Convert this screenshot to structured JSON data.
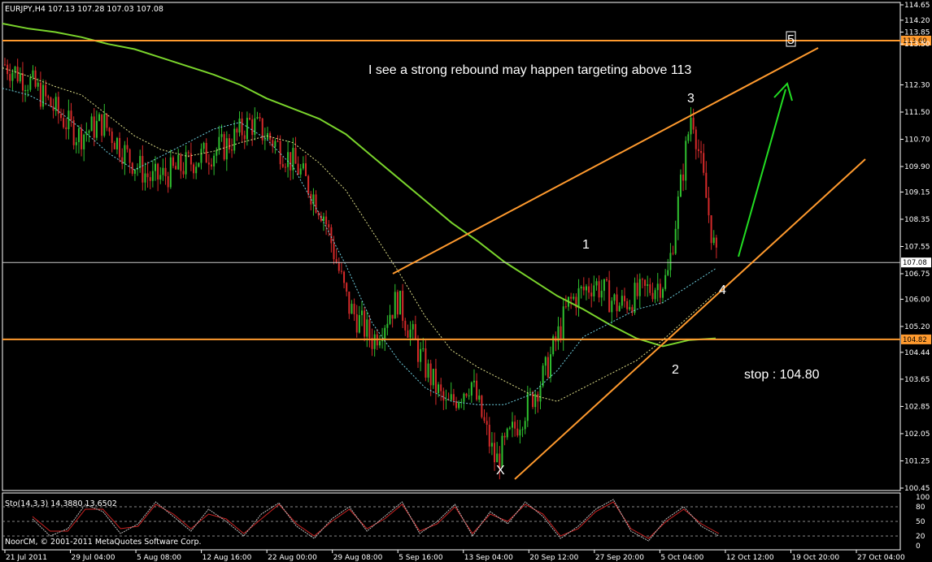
{
  "chart_data": {
    "type": "line",
    "title": "EURJPY,H4  107.13 107.28 107.03 107.08",
    "ylim": [
      100.45,
      114.65
    ],
    "y_ticks": [
      "114.65",
      "114.20",
      "113.85",
      "113.50",
      "112.30",
      "111.50",
      "110.70",
      "109.90",
      "109.15",
      "108.35",
      "107.55",
      "106.75",
      "106.00",
      "105.20",
      "104.44",
      "103.65",
      "102.85",
      "102.05",
      "101.25",
      "100.45"
    ],
    "price_tags": [
      {
        "label": "113.60",
        "value": 113.6,
        "style": "orange"
      },
      {
        "label": "107.08",
        "value": 107.08,
        "style": "white"
      },
      {
        "label": "104.82",
        "value": 104.82,
        "style": "orange"
      }
    ],
    "x_ticks": [
      "21 Jul 2011",
      "29 Jul 04:00",
      "5 Aug 08:00",
      "12 Aug 16:00",
      "22 Aug 00:00",
      "29 Aug 08:00",
      "5 Sep 16:00",
      "13 Sep 04:00",
      "20 Sep 12:00",
      "27 Sep 20:00",
      "5 Oct 04:00",
      "12 Oct 12:00",
      "19 Oct 20:00",
      "27 Oct 04:00"
    ],
    "x_tick_index": [
      0,
      1,
      2,
      3,
      4,
      5,
      6,
      7,
      8,
      9,
      10,
      11,
      12,
      13
    ],
    "series": [
      {
        "color": "#7ad42c",
        "values": [
          114.1,
          113.95,
          113.85,
          113.7,
          113.5,
          113.35,
          113.1,
          112.85,
          112.6,
          112.3,
          111.9,
          111.6,
          111.3,
          110.85,
          110.2,
          109.55,
          108.9,
          108.25,
          107.7,
          107.1,
          106.6,
          106.1,
          105.7,
          105.25,
          104.85,
          104.62,
          104.8,
          104.85
        ]
      },
      {
        "color": "#dddd88",
        "values": [
          112.8,
          112.55,
          112.25,
          112.0,
          111.4,
          110.8,
          110.4,
          110.2,
          110.35,
          110.6,
          110.8,
          110.6,
          110.0,
          109.2,
          108.0,
          106.8,
          105.5,
          104.5,
          104.0,
          103.6,
          103.2,
          103.0,
          103.4,
          103.8,
          104.2,
          104.8,
          105.5,
          106.2
        ]
      },
      {
        "color": "#6fd0e0",
        "values": [
          112.2,
          112.0,
          111.6,
          111.0,
          110.3,
          109.8,
          110.2,
          110.6,
          111.0,
          111.2,
          110.7,
          109.9,
          108.5,
          107.0,
          105.3,
          104.2,
          103.4,
          103.0,
          102.9,
          102.9,
          103.2,
          103.9,
          104.9,
          105.3,
          105.7,
          105.9,
          106.4,
          106.9
        ]
      },
      {
        "color": "#cc2222",
        "values": [
          112.9,
          112.4,
          111.6,
          110.8,
          111.2,
          110.2,
          109.5,
          109.8,
          110.2,
          110.5,
          111.2,
          110.6,
          109.8,
          108.5,
          105.8,
          104.8,
          106.0,
          104.2,
          102.8,
          103.6,
          101.2,
          102.5,
          103.8,
          105.9,
          106.5,
          105.8,
          106.2,
          106.6,
          111.6,
          107.1
        ]
      }
    ],
    "horizontal_levels": [
      113.6,
      107.08,
      104.82
    ],
    "wave_labels": [
      "X",
      "1",
      "2",
      "3",
      "4",
      "5"
    ],
    "annotations": {
      "note": "I see a strong rebound may happen targeting above 113",
      "stop": "stop : 104.80"
    },
    "stochastic": {
      "label": "Sto(14,3,3) 14.3880 13.6502",
      "levels": [
        "100",
        "80",
        "50",
        "20",
        "0"
      ],
      "main": [
        55,
        20,
        35,
        85,
        70,
        25,
        45,
        90,
        60,
        30,
        75,
        50,
        20,
        65,
        88,
        40,
        15,
        55,
        80,
        30,
        60,
        90,
        25,
        50,
        85,
        20,
        70,
        45,
        90,
        60,
        15,
        40,
        75,
        95,
        30,
        10,
        55,
        80,
        40,
        20
      ],
      "signal": [
        60,
        30,
        30,
        75,
        75,
        35,
        40,
        85,
        65,
        35,
        65,
        55,
        25,
        55,
        85,
        45,
        20,
        50,
        75,
        35,
        55,
        85,
        30,
        45,
        80,
        25,
        65,
        50,
        85,
        65,
        20,
        35,
        70,
        90,
        35,
        15,
        50,
        75,
        45,
        25
      ]
    },
    "copyright": "NoorCM, © 2001-2011 MetaQuotes Software Corp."
  }
}
